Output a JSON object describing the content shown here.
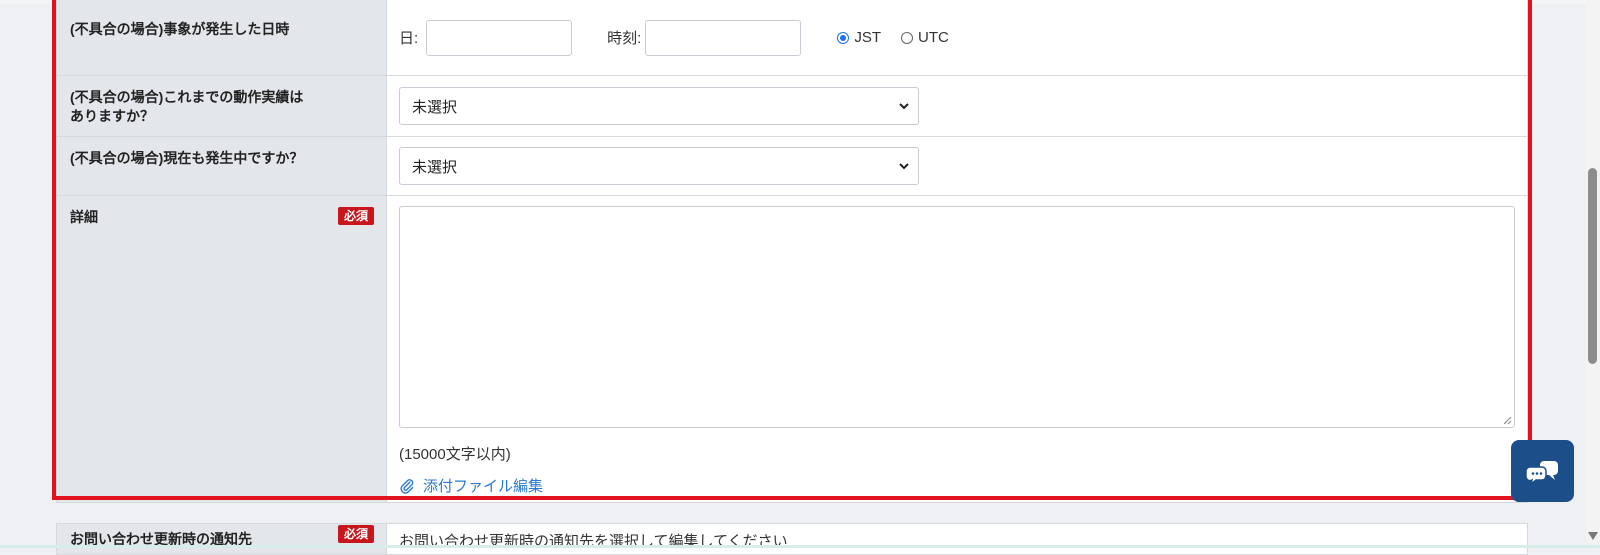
{
  "rows": {
    "occurrence": {
      "label": "(不具合の場合)事象が発生した日時",
      "day_label": "日:",
      "time_label": "時刻:",
      "day_value": "",
      "time_value": "",
      "tz_options": [
        "JST",
        "UTC"
      ],
      "tz_selected": "JST"
    },
    "history": {
      "label_line1": "(不具合の場合)これまでの動作実績は",
      "label_line2": "ありますか？",
      "selected": "未選択"
    },
    "ongoing": {
      "label": "(不具合の場合)現在も発生中ですか？",
      "selected": "未選択"
    },
    "details": {
      "label": "詳細",
      "required_badge": "必須",
      "value": "",
      "limit_note": "(15000文字以内)",
      "attach_label": "添付ファイル編集"
    }
  },
  "next_row": {
    "label": "お問い合わせ更新時の通知先",
    "required_badge": "必須",
    "text": "お問い合わせ更新時の通知先を選択して編集してください"
  },
  "colors": {
    "highlight_frame": "#e0131e",
    "required_badge": "#c8161d",
    "link": "#2a7ad2",
    "chat_button": "#1c4e8a"
  },
  "icons": {
    "attach": "paperclip-icon",
    "chat": "chat-bubbles-icon",
    "select": "chevron-down-icon"
  }
}
